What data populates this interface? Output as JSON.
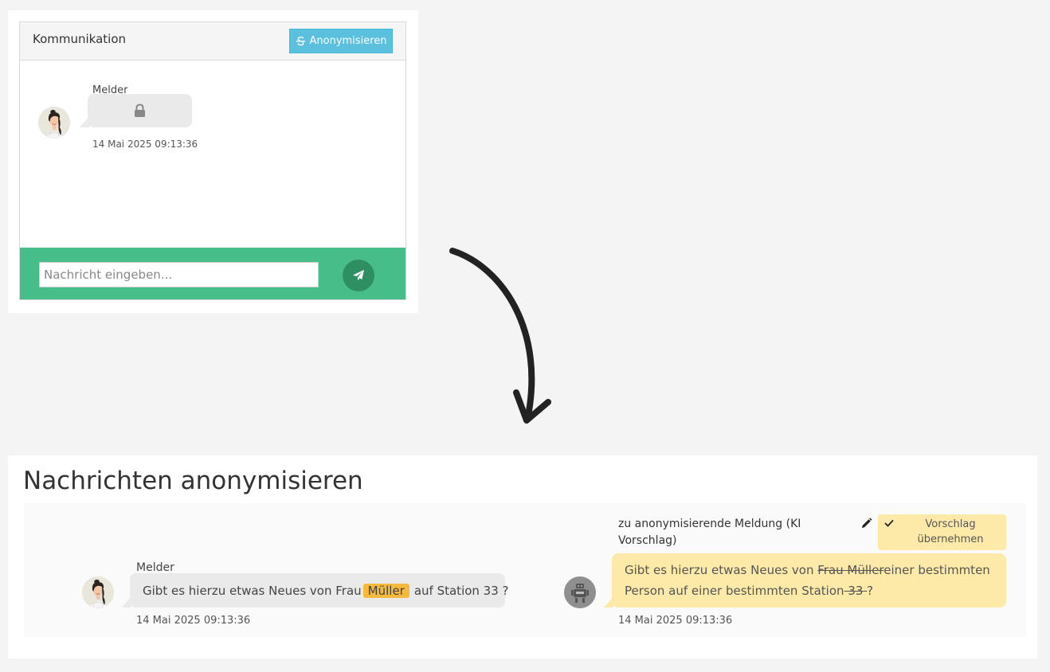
{
  "top": {
    "panel_title": "Kommunikation",
    "anonymize_button": "Anonymisieren",
    "sender": "Melder",
    "timestamp": "14 Mai 2025 09:13:36",
    "input_placeholder": "Nachricht eingeben...",
    "message_locked": true
  },
  "bottom": {
    "title": "Nachrichten anonymisieren",
    "original": {
      "sender": "Melder",
      "text_before": "Gibt es hierzu etwas Neues von Frau",
      "highlight": "Müller",
      "text_after": "auf Station 33 ?",
      "timestamp": "14 Mai 2025 09:13:36"
    },
    "suggestion": {
      "label": "zu anonymisierende Meldung (KI Vorschlag)",
      "accept_button": "Vorschlag übernehmen",
      "text_1": "Gibt es hierzu etwas Neues von ",
      "struck_1": "Frau Müller",
      "text_2": "einer bestimmten Person auf einer bestimmten Station",
      "struck_2": " 33 ",
      "text_3": "?",
      "timestamp": "14 Mai 2025 09:13:36"
    }
  },
  "colors": {
    "info_button": "#5bc0de",
    "input_bar": "#47bd8a",
    "send_button": "#2e8f63",
    "highlight": "#f5b93c",
    "suggestion_bg": "#fde9a8",
    "bubble_gray": "#eaeaea"
  },
  "icons": {
    "anonymize": "strikethrough-icon",
    "locked_message": "lock-icon",
    "send": "paper-plane-icon",
    "edit": "pencil-icon",
    "accept": "check-icon",
    "ki": "robot-icon"
  }
}
